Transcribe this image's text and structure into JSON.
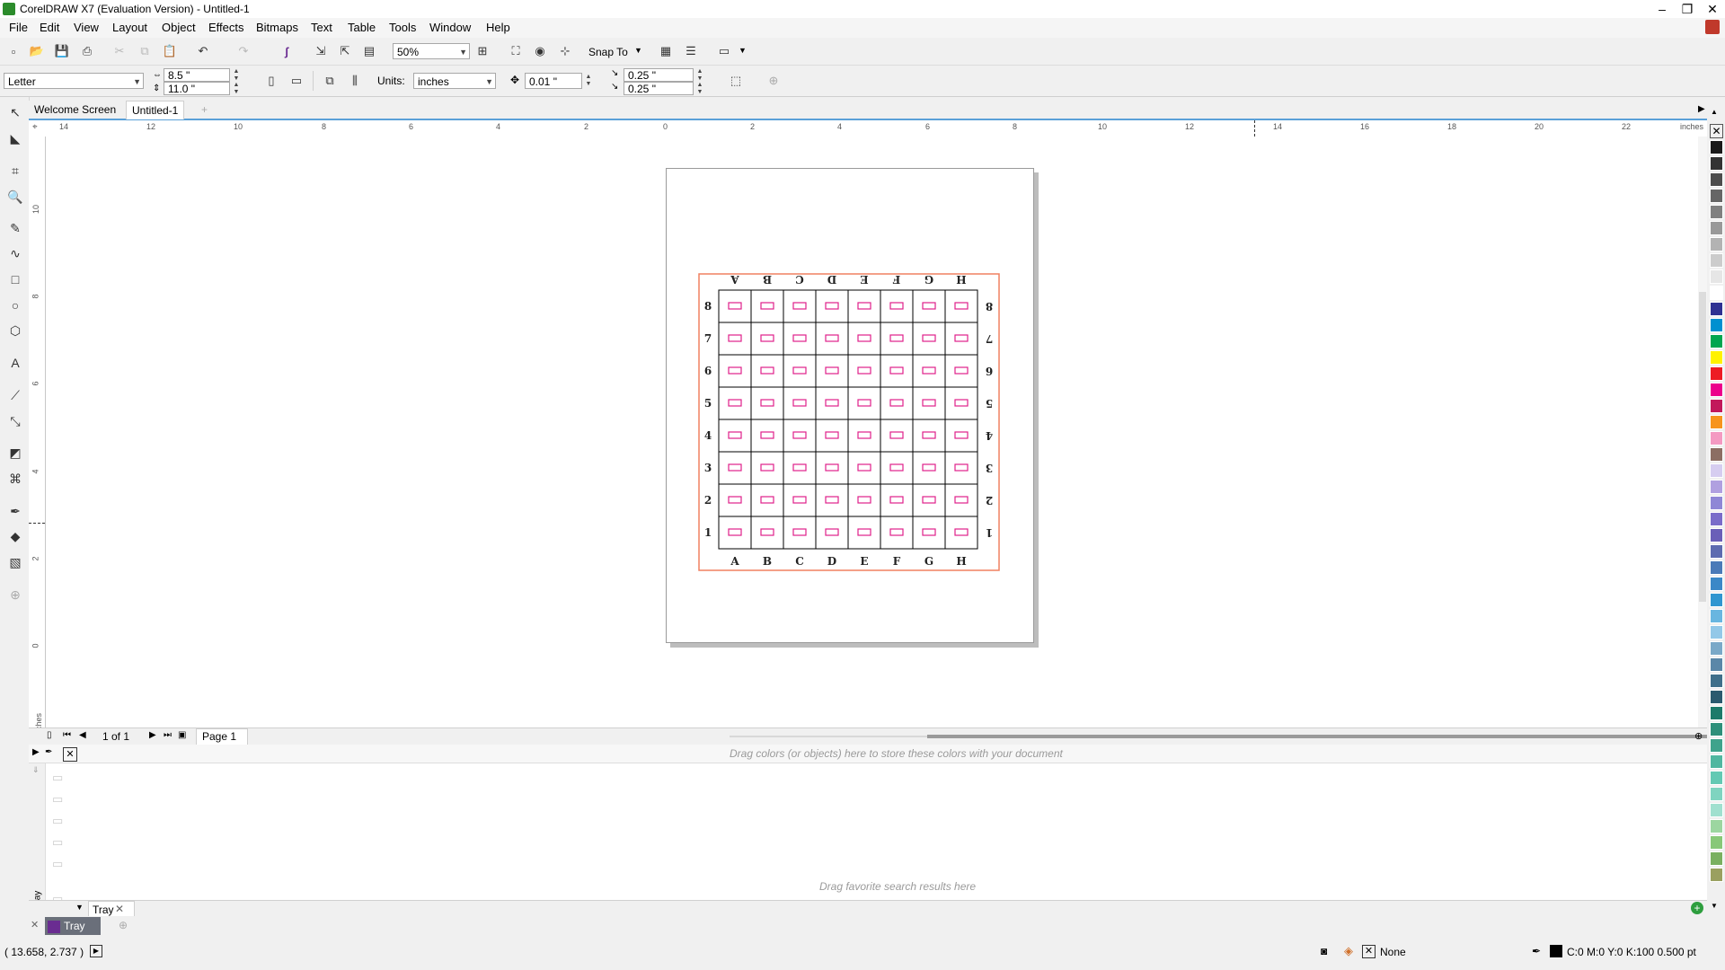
{
  "window": {
    "title": "CorelDRAW X7 (Evaluation Version) - Untitled-1",
    "controls": [
      "–",
      "❐",
      "✕"
    ]
  },
  "menu": [
    "File",
    "Edit",
    "View",
    "Layout",
    "Object",
    "Effects",
    "Bitmaps",
    "Text",
    "Table",
    "Tools",
    "Window",
    "Help"
  ],
  "standard_toolbar": {
    "zoom": "50%",
    "snap_to": "Snap To"
  },
  "property_bar": {
    "paper_size": "Letter",
    "width": "8.5 \"",
    "height": "11.0 \"",
    "units_label": "Units:",
    "units": "inches",
    "nudge": "0.01 \"",
    "dup_x": "0.25 \"",
    "dup_y": "0.25 \""
  },
  "tabs": {
    "welcome": "Welcome Screen",
    "doc": "Untitled-1"
  },
  "rulers": {
    "h_labels": [
      "14",
      "12",
      "10",
      "8",
      "6",
      "4",
      "2",
      "0",
      "2",
      "4",
      "6",
      "8",
      "10",
      "12",
      "14",
      "16",
      "18",
      "20",
      "22"
    ],
    "h_units": "inches",
    "v_labels": [
      "10",
      "8",
      "6",
      "4",
      "2",
      "0"
    ],
    "v_units": "inches"
  },
  "board": {
    "columns": [
      "A",
      "B",
      "C",
      "D",
      "E",
      "F",
      "G",
      "H"
    ],
    "rows": [
      "8",
      "7",
      "6",
      "5",
      "4",
      "3",
      "2",
      "1"
    ],
    "border_color": "#f08060",
    "cell_mark_color": "#e0208a"
  },
  "page_nav": {
    "counter": "1 of 1",
    "page_tab": "Page 1"
  },
  "doc_palette": {
    "hint": "Drag colors (or objects) here to store these colors with your document"
  },
  "tray": {
    "hint": "Drag favorite search results here",
    "tab": "Tray",
    "side_label": "Tray",
    "bottom_tab": "Tray"
  },
  "status": {
    "coords": "( 13.658, 2.737 )",
    "fill": "None",
    "outline": "C:0 M:0 Y:0 K:100  0.500 pt"
  },
  "palette_colors": [
    "#1a1a1a",
    "#333333",
    "#4d4d4d",
    "#666666",
    "#808080",
    "#999999",
    "#b3b3b3",
    "#cccccc",
    "#e6e6e6",
    "#ffffff",
    "#2e3192",
    "#0090d0",
    "#00a650",
    "#fff200",
    "#ed1c24",
    "#ec008c",
    "#c2185b",
    "#f7941d",
    "#f49ac2",
    "#8c6e63",
    "#d6cdf0",
    "#b0a0e0",
    "#8f87d6",
    "#7a6cc9",
    "#6a5fb8",
    "#5d6bb0",
    "#4a7ab8",
    "#3b88c7",
    "#2f96d0",
    "#69b6e0",
    "#93c8e8",
    "#7aa9c8",
    "#5a87a8",
    "#3f6f8a",
    "#2a5a6f",
    "#1c7a6a",
    "#2e8f7a",
    "#3fa38c",
    "#50b7a0",
    "#63c9b3",
    "#7fd4c0",
    "#a0e0cf",
    "#9cd6a0",
    "#88c878",
    "#7ab060",
    "#9aa060"
  ]
}
